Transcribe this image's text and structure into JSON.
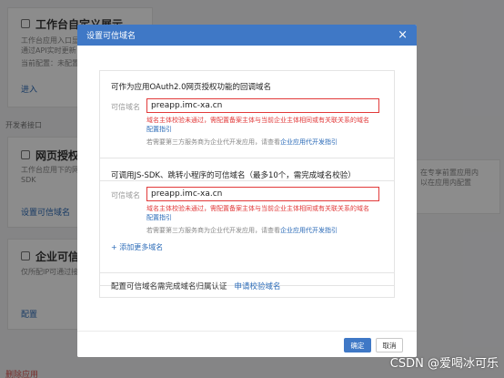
{
  "background": {
    "card1_title": "工作台自定义展示",
    "card1_desc1": "工作台应用入口显",
    "card1_desc2": "通过API实时更新",
    "card1_status": "当前配置：未配置",
    "card1_link": "进入",
    "section_label": "开发者接口",
    "card2_title": "网页授权及",
    "card2_desc1": "工作台应用下的网页",
    "card2_desc2": "SDK",
    "card2_link": "设置可信域名",
    "card3_title": "企业可信",
    "card3_desc1": "仅所配IP可通过接",
    "card3_link": "配置",
    "right_desc1": "在专享前置应用内",
    "right_desc2": "以在应用内配置",
    "delete_link": "删除应用"
  },
  "dialog": {
    "title": "设置可信域名",
    "close_icon": "×",
    "panel1": {
      "title": "可作为应用OAuth2.0网页授权功能的回调域名",
      "field_label": "可信域名",
      "input_value": "preapp.imc-xa.cn",
      "error": "域名主体校验未通过，需配置备案主体与当前企业主体相同或有关联关系的域名",
      "guide_link": "配置指引",
      "note_prefix": "若需要第三方服务商为企业代开发应用，请查看",
      "note_link": "企业应用代开发指引"
    },
    "panel2": {
      "title": "可调用JS-SDK、跳转小程序的可信域名（最多10个，需完成域名校验）",
      "field_label": "可信域名",
      "input_value": "preapp.imc-xa.cn",
      "error": "域名主体校验未通过，需配置备案主体与当前企业主体相同或有关联关系的域名",
      "guide_link": "配置指引",
      "note_prefix": "若需要第三方服务商为企业代开发应用，请查看",
      "note_link": "企业应用代开发指引",
      "add_more": "+ 添加更多域名"
    },
    "panel3": {
      "text": "配置可信域名需完成域名归属认证",
      "link": "申请校验域名"
    },
    "ok_label": "确定",
    "cancel_label": "取消"
  },
  "watermark": "CSDN @爱喝冰可乐"
}
